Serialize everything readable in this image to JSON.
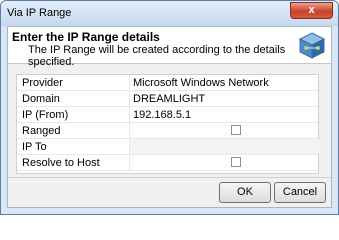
{
  "window": {
    "title": "Via IP Range",
    "close_glyph": "x"
  },
  "header": {
    "title": "Enter the IP Range details",
    "subtitle": "The IP Range will be created according to the details specified.",
    "icon": "network-cube-icon"
  },
  "fields": [
    {
      "label": "Provider",
      "value": "Microsoft Windows Network",
      "type": "text"
    },
    {
      "label": "Domain",
      "value": "DREAMLIGHT",
      "type": "text"
    },
    {
      "label": "IP (From)",
      "value": "192.168.5.1",
      "type": "text"
    },
    {
      "label": "Ranged",
      "checked": false,
      "type": "checkbox"
    },
    {
      "label": "IP To",
      "value": "",
      "type": "text"
    },
    {
      "label": "Resolve to Host",
      "checked": false,
      "type": "checkbox"
    }
  ],
  "buttons": {
    "ok": "OK",
    "cancel": "Cancel"
  },
  "colors": {
    "title_bar": "#c5d8ee",
    "close_button": "#c9412a",
    "frame": "#d9e6f4"
  }
}
